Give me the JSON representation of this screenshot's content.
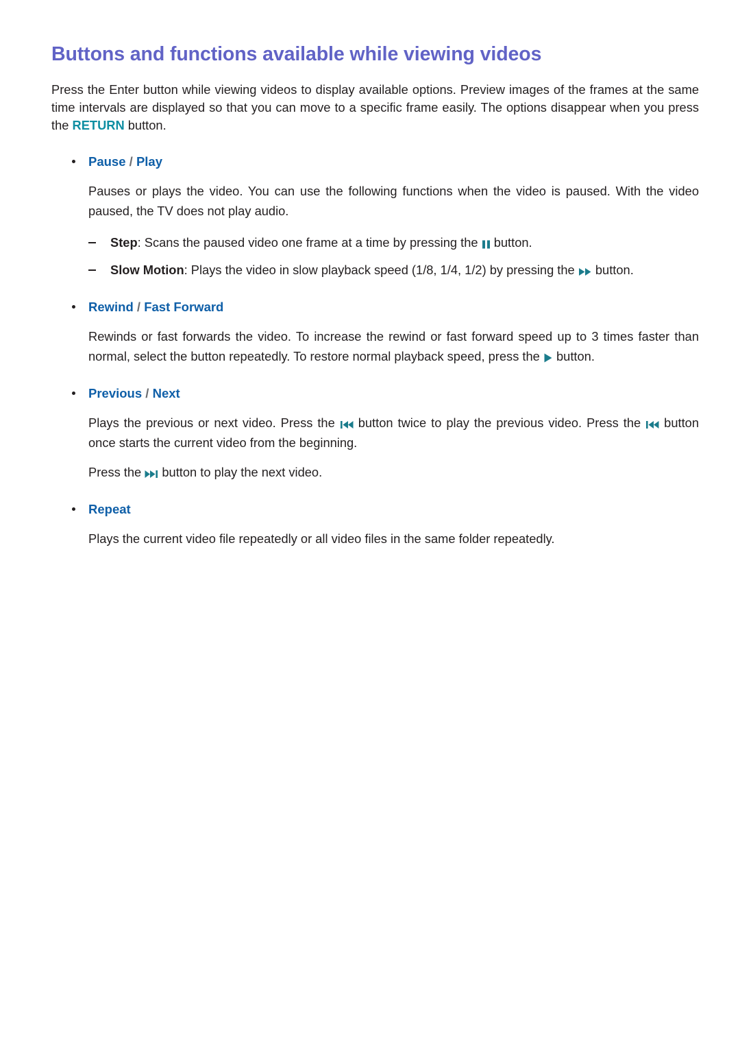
{
  "document": {
    "title": "Buttons and functions available while viewing videos",
    "intro": {
      "part1": "Press the Enter button while viewing videos to display available options. Preview images of the frames at the same time intervals are displayed so that you can move to a specific frame easily. The options disappear when you press the ",
      "keyword": "RETURN",
      "part2": " button."
    },
    "sections": [
      {
        "heading_left": "Pause",
        "separator": " / ",
        "heading_right": "Play",
        "body": "Pauses or plays the video. You can use the following functions when the video is paused. With the video paused, the TV does not play audio.",
        "subitems": [
          {
            "term": "Step",
            "text_before": ": Scans the paused video one frame at a time by pressing the ",
            "icon": "pause-icon",
            "text_after": " button."
          },
          {
            "term": "Slow Motion",
            "text_before": ": Plays the video in slow playback speed (1/8, 1/4, 1/2) by pressing the ",
            "icon": "fast-forward-icon",
            "text_after": " button."
          }
        ]
      },
      {
        "heading_left": "Rewind",
        "separator": " / ",
        "heading_right": "Fast Forward",
        "body_before": "Rewinds or fast forwards the video. To increase the rewind or fast forward speed up to 3 times faster than normal, select the button repeatedly. To restore normal playback speed, press the ",
        "icon": "play-icon",
        "body_after": " button."
      },
      {
        "heading_left": "Previous",
        "separator": " / ",
        "heading_right": "Next",
        "para1_a": "Plays the previous or next video. Press the ",
        "para1_icon1": "previous-icon",
        "para1_b": " button twice to play the previous video. Press the ",
        "para1_icon2": "previous-icon",
        "para1_c": " button once starts the current video from the beginning.",
        "para2_a": "Press the ",
        "para2_icon": "next-icon",
        "para2_b": " button to play the next video."
      },
      {
        "heading_left": "Repeat",
        "body": "Plays the current video file repeatedly or all video files in the same folder repeatedly."
      }
    ]
  },
  "colors": {
    "title": "#6163c6",
    "heading": "#0f5fa8",
    "keyword": "#0f8ea2",
    "icon": "#1b7c8c",
    "text": "#231f20",
    "separator": "#6d6e71",
    "background": "#ffffff"
  }
}
